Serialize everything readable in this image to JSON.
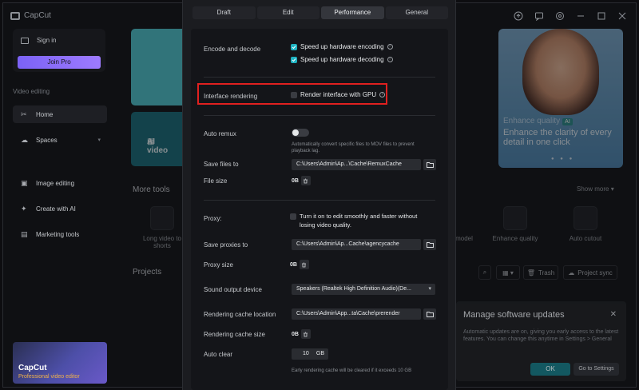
{
  "app": {
    "name": "CapCut"
  },
  "sidebar": {
    "sign_in": "Sign in",
    "join_pro": "Join Pro",
    "section_video": "Video editing",
    "items": [
      {
        "label": "Home"
      },
      {
        "label": "Spaces"
      },
      {
        "label": "Image editing"
      },
      {
        "label": "Create with AI"
      },
      {
        "label": "Marketing tools"
      }
    ],
    "promo": {
      "title": "CapCut",
      "subtitle": "Professional video editor"
    }
  },
  "main": {
    "hero_ai_video": "AI video",
    "hero_right": {
      "tag": "Enhance quality",
      "badge": "AI",
      "headline": "Enhance the clarity of every detail in one click"
    },
    "more_tools": "More tools",
    "show_more": "Show more",
    "tools": [
      {
        "label": "Long video to shorts"
      },
      {
        "label": "model"
      },
      {
        "label": "Enhance quality"
      },
      {
        "label": "Auto cutout"
      }
    ],
    "projects": "Projects",
    "trash": "Trash",
    "project_sync": "Project sync"
  },
  "toast": {
    "title": "Manage software updates",
    "body": "Automatic updates are on, giving you early access to the latest features. You can change this anytime in Settings > General",
    "ok": "OK",
    "go": "Go to Settings"
  },
  "settings": {
    "tabs": [
      "Draft",
      "Edit",
      "Performance",
      "General"
    ],
    "active_tab": "Performance",
    "encode_label": "Encode and decode",
    "hw_encoding": "Speed up hardware encoding",
    "hw_decoding": "Speed up hardware decoding",
    "render_label": "Interface rendering",
    "render_gpu": "Render interface with GPU",
    "auto_remux_label": "Auto remux",
    "auto_remux_help": "Automatically convert specific files to MOV files to prevent playback lag.",
    "save_files_label": "Save files to",
    "save_files_path": "C:\\Users\\Admin\\Ap...\\Cache\\RemuxCache",
    "file_size_label": "File size",
    "file_size_value": "0B",
    "proxy_label": "Proxy:",
    "proxy_text": "Turn it on to edit smoothly and faster without losing video quality.",
    "save_proxies_label": "Save proxies to",
    "save_proxies_path": "C:\\Users\\Admin\\Ap...Cache\\agencycache",
    "proxy_size_label": "Proxy size",
    "proxy_size_value": "0B",
    "sound_label": "Sound output device",
    "sound_value": "Speakers (Realtek High Definition Audio)(De...",
    "render_cache_label": "Rendering cache location",
    "render_cache_path": "C:\\Users\\Admin\\App...ta\\Cache\\prerender",
    "render_cache_size_label": "Rendering cache size",
    "render_cache_size_value": "0B",
    "auto_clear_label": "Auto clear",
    "auto_clear_value": "10",
    "auto_clear_unit": "GB",
    "auto_clear_help": "Early rendering cache will be cleared if it exceeds 10 GB"
  },
  "colors": {
    "accent": "#1fb3c2",
    "highlight": "#e0201f",
    "pro": "#8b6cf7"
  }
}
